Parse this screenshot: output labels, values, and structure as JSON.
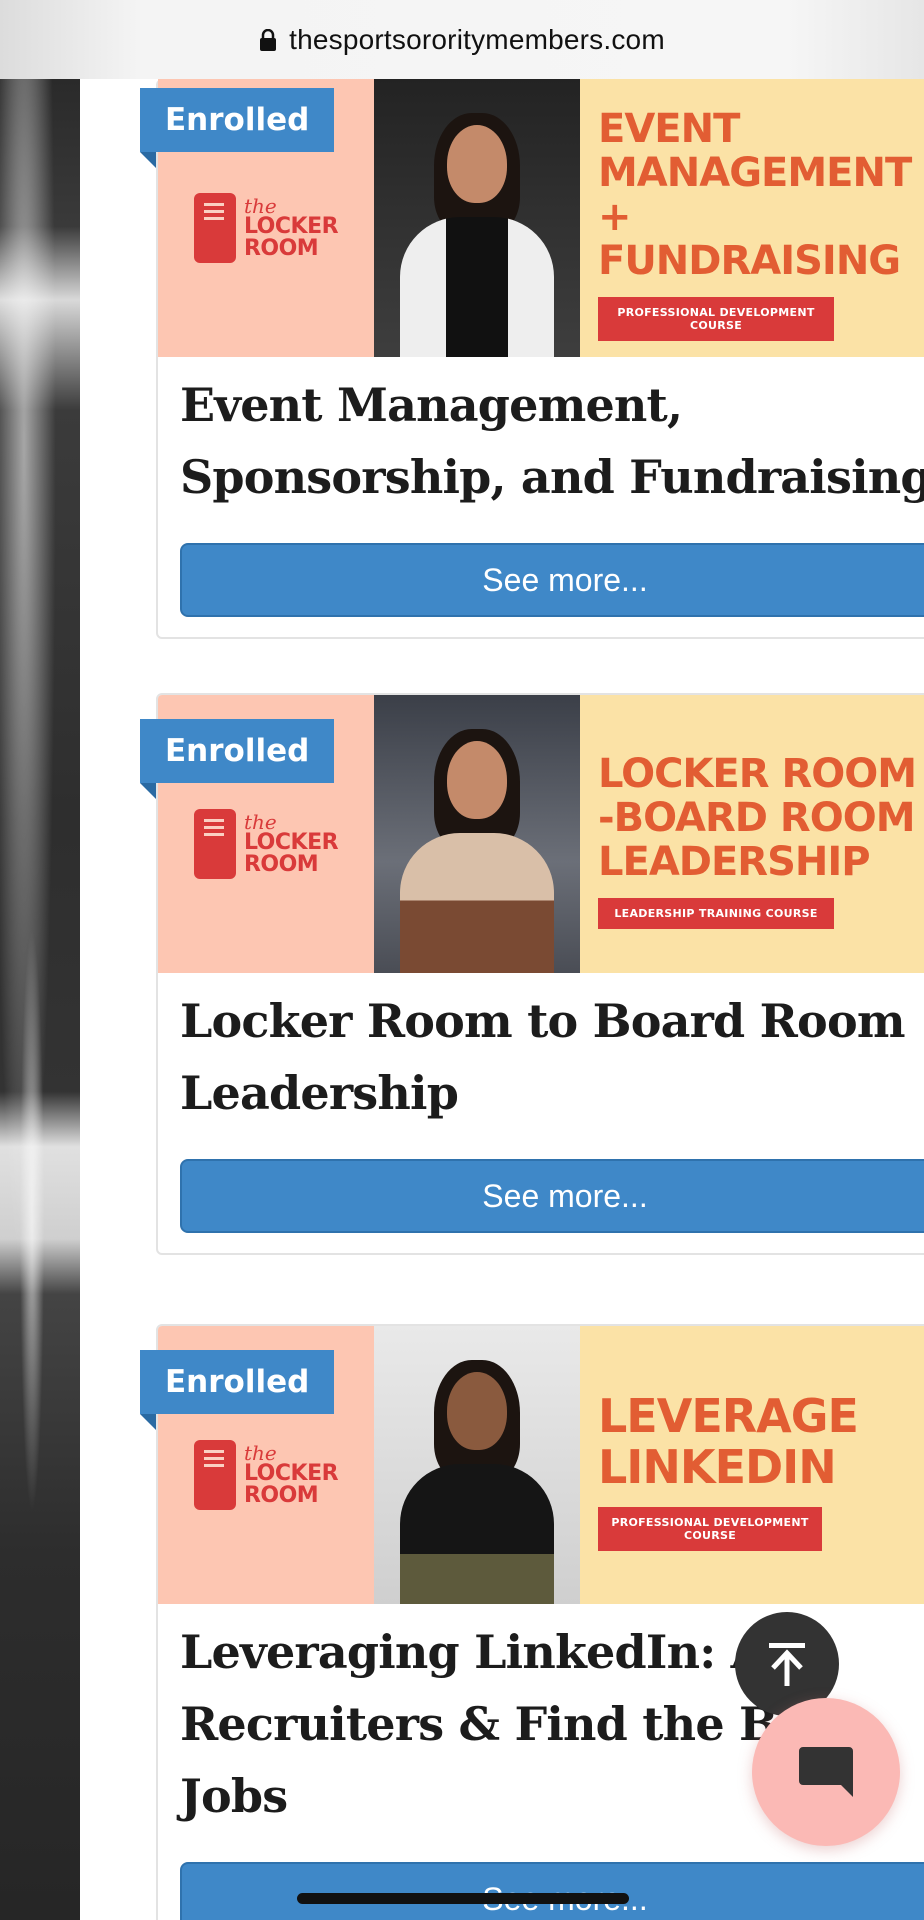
{
  "browser": {
    "url": "thesportsororitymembers.com"
  },
  "brand": {
    "logo_the": "the",
    "logo_line1": "LOCKER",
    "logo_line2": "ROOM"
  },
  "courses": [
    {
      "badge": "Enrolled",
      "banner_headline": [
        "EVENT",
        "MANAGEMENT +",
        "FUNDRAISING"
      ],
      "banner_tag": "PROFESSIONAL DEVELOPMENT COURSE",
      "title": "Event Management, Sponsorship, and Fundraising",
      "button": "See more..."
    },
    {
      "badge": "Enrolled",
      "banner_headline": [
        "LOCKER ROOM",
        "-BOARD ROOM",
        "LEADERSHIP"
      ],
      "banner_tag": "LEADERSHIP TRAINING COURSE",
      "title": "Locker Room to Board Room Leadership",
      "button": "See more..."
    },
    {
      "badge": "Enrolled",
      "banner_headline": [
        "LEVERAGE",
        "LINKEDIN"
      ],
      "banner_tag": "PROFESSIONAL DEVELOPMENT COURSE",
      "title": "Leveraging LinkedIn: Att Recruiters & Find the Best Jobs",
      "button": "See more..."
    }
  ],
  "colors": {
    "accent": "#3f88c8",
    "banner_peach": "#fdc6b2",
    "banner_cream": "#fbe2a6",
    "brand_red": "#d93a3a",
    "headline_orange": "#e25d33",
    "chat_pink": "#fbb9b5"
  },
  "icons": {
    "lock": "lock-icon",
    "back_to_top": "arrow-up-to-line-icon",
    "chat": "chat-bubble-icon"
  }
}
